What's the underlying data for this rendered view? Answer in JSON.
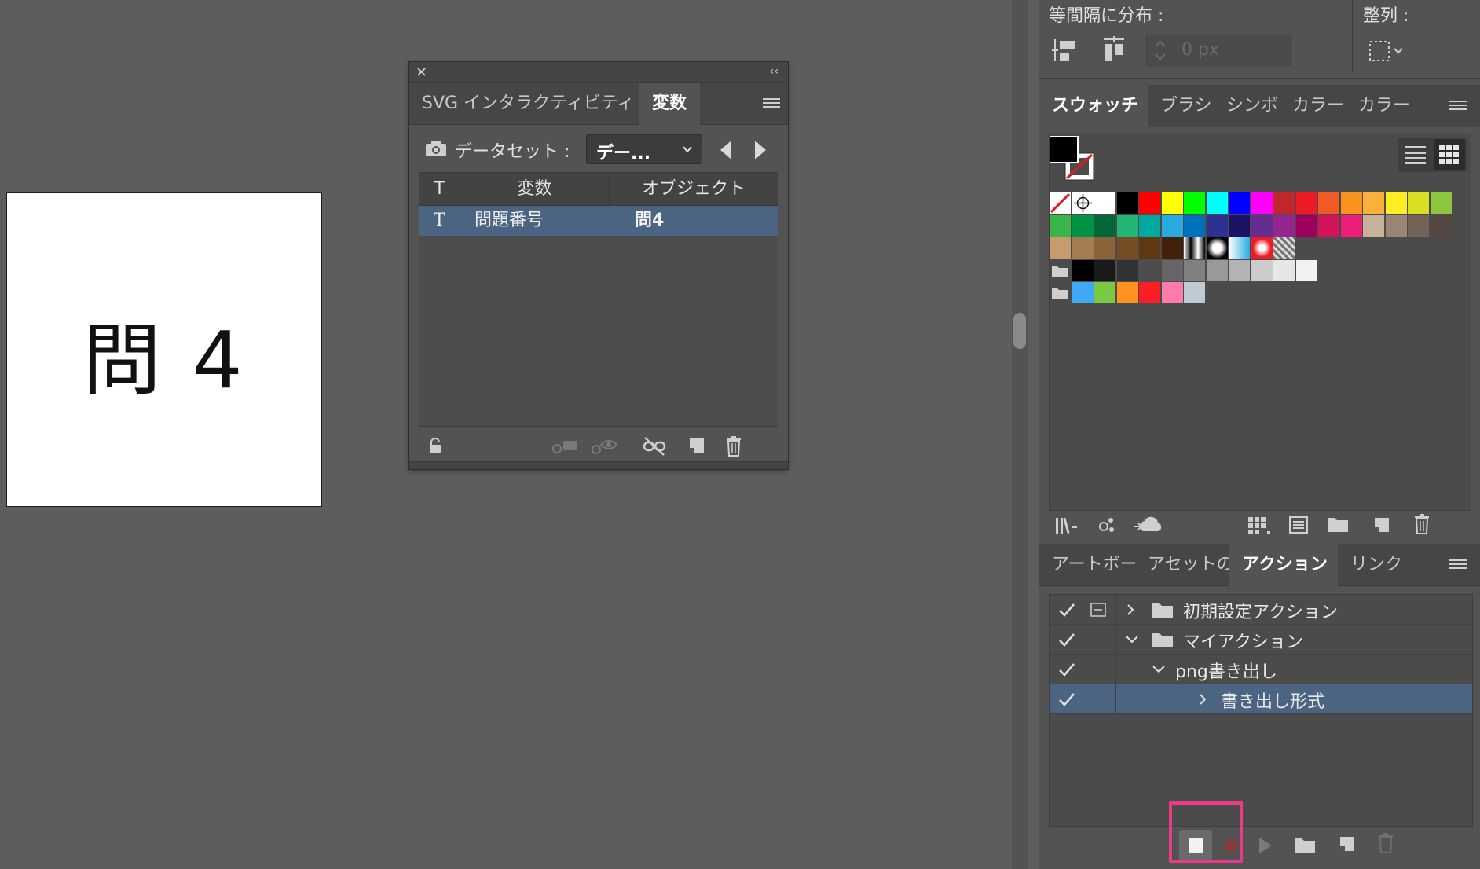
{
  "artboard": {
    "text": "問 4"
  },
  "variables_panel": {
    "tabs": [
      {
        "label": "SVG インタラクティビティ",
        "active": false
      },
      {
        "label": "変数",
        "active": true
      }
    ],
    "close_glyph": "✕",
    "collapse_glyph": "‹‹",
    "dataset_label": "データセット :",
    "dataset_value": "デー...",
    "columns": [
      "T",
      "変数",
      "オブジェクト"
    ],
    "rows": [
      {
        "type_glyph": "T",
        "variable": "問題番号",
        "object": "問4",
        "selected": true
      }
    ],
    "footer_icons": [
      "lock-icon",
      "capture-dataset-icon",
      "visibility-icon",
      "unbind-icon",
      "new-variable-icon",
      "trash-icon"
    ]
  },
  "dock": {
    "distribute_label": "等間隔に分布 :",
    "align_to_label": "整列 :",
    "spacing_value": "0 px",
    "swatch_tabs": [
      {
        "label": "スウォッチ",
        "active": true
      },
      {
        "label": "ブラシ",
        "active": false
      },
      {
        "label": "シンボ",
        "active": false
      },
      {
        "label": "カラー",
        "active": false
      },
      {
        "label": "カラー",
        "active": false
      }
    ],
    "swatch_rows": [
      [
        "none",
        "registration",
        "#ffffff",
        "#000000",
        "#ff0000",
        "#ffff00",
        "#00ff00",
        "#00ffff",
        "#0000ff",
        "#ff00ff",
        "#c1272d",
        "#ed1c24",
        "#f15a24",
        "#f7931e",
        "#fbb03b",
        "#fcee21",
        "#d9e021",
        "#8cc63f"
      ],
      [
        "#39b54a",
        "#009245",
        "#006837",
        "#22b573",
        "#00a99d",
        "#29abe2",
        "#0071bc",
        "#2e3192",
        "#1b1464",
        "#662d91",
        "#93278f",
        "#9e005d",
        "#d4145a",
        "#ed1e79",
        "#c7b299",
        "#998675",
        "#736357",
        "#534741"
      ],
      [
        "#c69c6d",
        "#a67c52",
        "#8c6239",
        "#754c24",
        "#603813",
        "#42210b",
        "grad-bw",
        "grad-radial",
        "grad-cyan",
        "grad-red",
        "pattern"
      ],
      [
        "folder",
        "#000000",
        "#1a1a1a",
        "#333333",
        "#4d4d4d",
        "#666666",
        "#808080",
        "#999999",
        "#b3b3b3",
        "#cccccc",
        "#e6e6e6",
        "#f2f2f2"
      ],
      [
        "folder",
        "#3fa9f5",
        "#7ac943",
        "#ff931e",
        "#ff1d25",
        "#ff7bac",
        "#bdccd4"
      ]
    ],
    "action_tabs": [
      {
        "label": "アートボー",
        "active": false
      },
      {
        "label": "アセットの",
        "active": false
      },
      {
        "label": "アクション",
        "active": true
      },
      {
        "label": "リンク",
        "active": false
      }
    ],
    "actions": [
      {
        "label": "初期設定アクション",
        "level": 0,
        "expanded": false,
        "kind": "set",
        "dialog": true
      },
      {
        "label": "マイアクション",
        "level": 0,
        "expanded": true,
        "kind": "set",
        "dialog": false
      },
      {
        "label": "png書き出し",
        "level": 1,
        "expanded": true,
        "kind": "action",
        "dialog": false
      },
      {
        "label": "書き出し形式",
        "level": 2,
        "expanded": false,
        "kind": "step",
        "dialog": false,
        "selected": true
      }
    ]
  },
  "colors": {
    "canvas": "#5d5d5d",
    "panel": "#535353",
    "selection": "#4b6482",
    "highlight": "#ee3a86"
  }
}
